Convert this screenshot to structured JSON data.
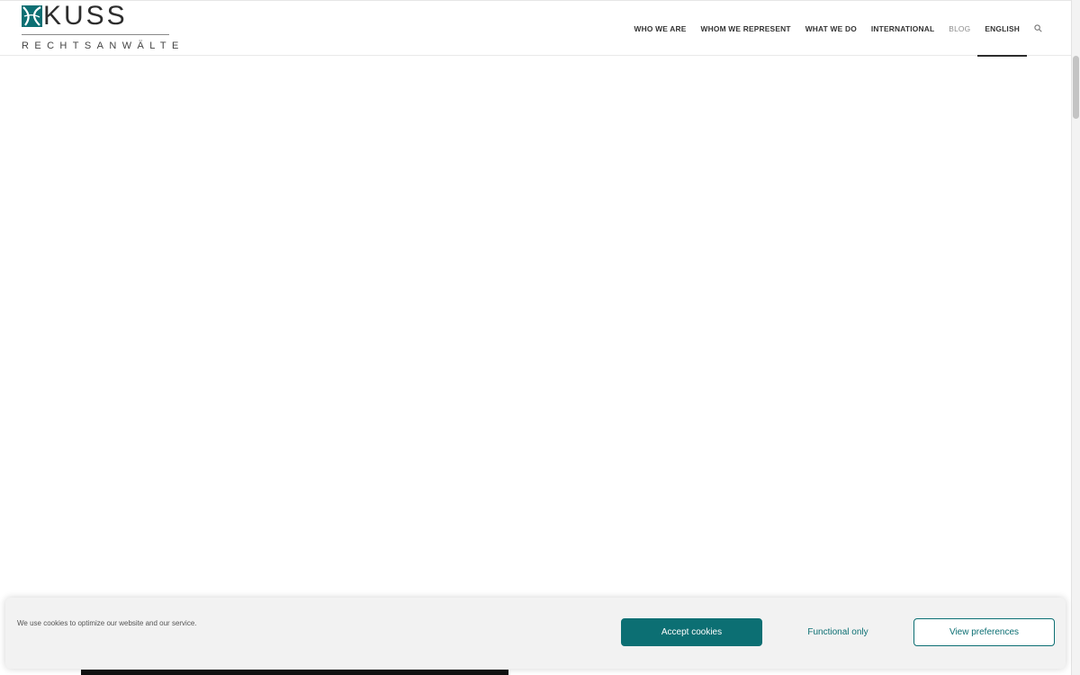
{
  "header": {
    "logo": {
      "wordmark": "KUSS",
      "tagline": "RECHTSANWÄLTE",
      "brand_color": "#0c6f73"
    },
    "nav": [
      {
        "id": "who-we-are",
        "label": "WHO WE ARE"
      },
      {
        "id": "whom-we-represent",
        "label": "WHOM WE REPRESENT"
      },
      {
        "id": "what-we-do",
        "label": "WHAT WE DO"
      },
      {
        "id": "international",
        "label": "INTERNATIONAL"
      },
      {
        "id": "blog",
        "label": "BLOG"
      },
      {
        "id": "english",
        "label": "ENGLISH",
        "active": true
      }
    ],
    "search_icon": "search-icon"
  },
  "cookie_banner": {
    "message": "We use cookies to optimize our website and our service.",
    "accept_label": "Accept cookies",
    "functional_label": "Functional only",
    "preferences_label": "View preferences",
    "accent_color": "#0c6f73"
  }
}
